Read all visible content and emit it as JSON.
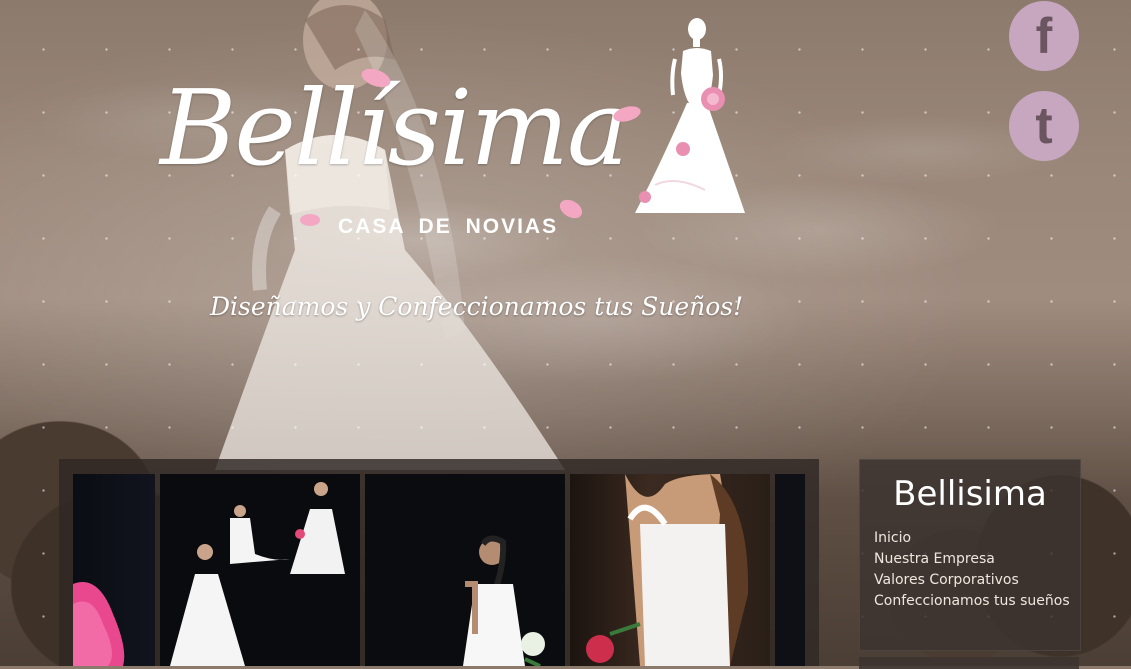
{
  "header": {
    "logo_script": "Bellísima",
    "logo_subtitle": "CASA DE NOVIAS",
    "tagline": "Diseñamos y Confeccionamos tus Sueños!"
  },
  "social": {
    "facebook_glyph": "f",
    "twitter_glyph": "t",
    "icons": [
      "facebook-icon",
      "twitter-icon"
    ],
    "icon_color": "#c7a6bf"
  },
  "sidebar": {
    "title": "Bellisima",
    "menu": [
      "Inicio",
      "Nuestra Empresa",
      "Valores Corporativos",
      "Confeccionamos tus sueños"
    ]
  },
  "gallery": {
    "photos": [
      "photo-1",
      "photo-2",
      "photo-3",
      "photo-4",
      "photo-5"
    ]
  },
  "colors": {
    "accent_pink": "#e9a3c0",
    "social_pink": "#c7a6bf",
    "panel_bg": "#3c3430"
  }
}
